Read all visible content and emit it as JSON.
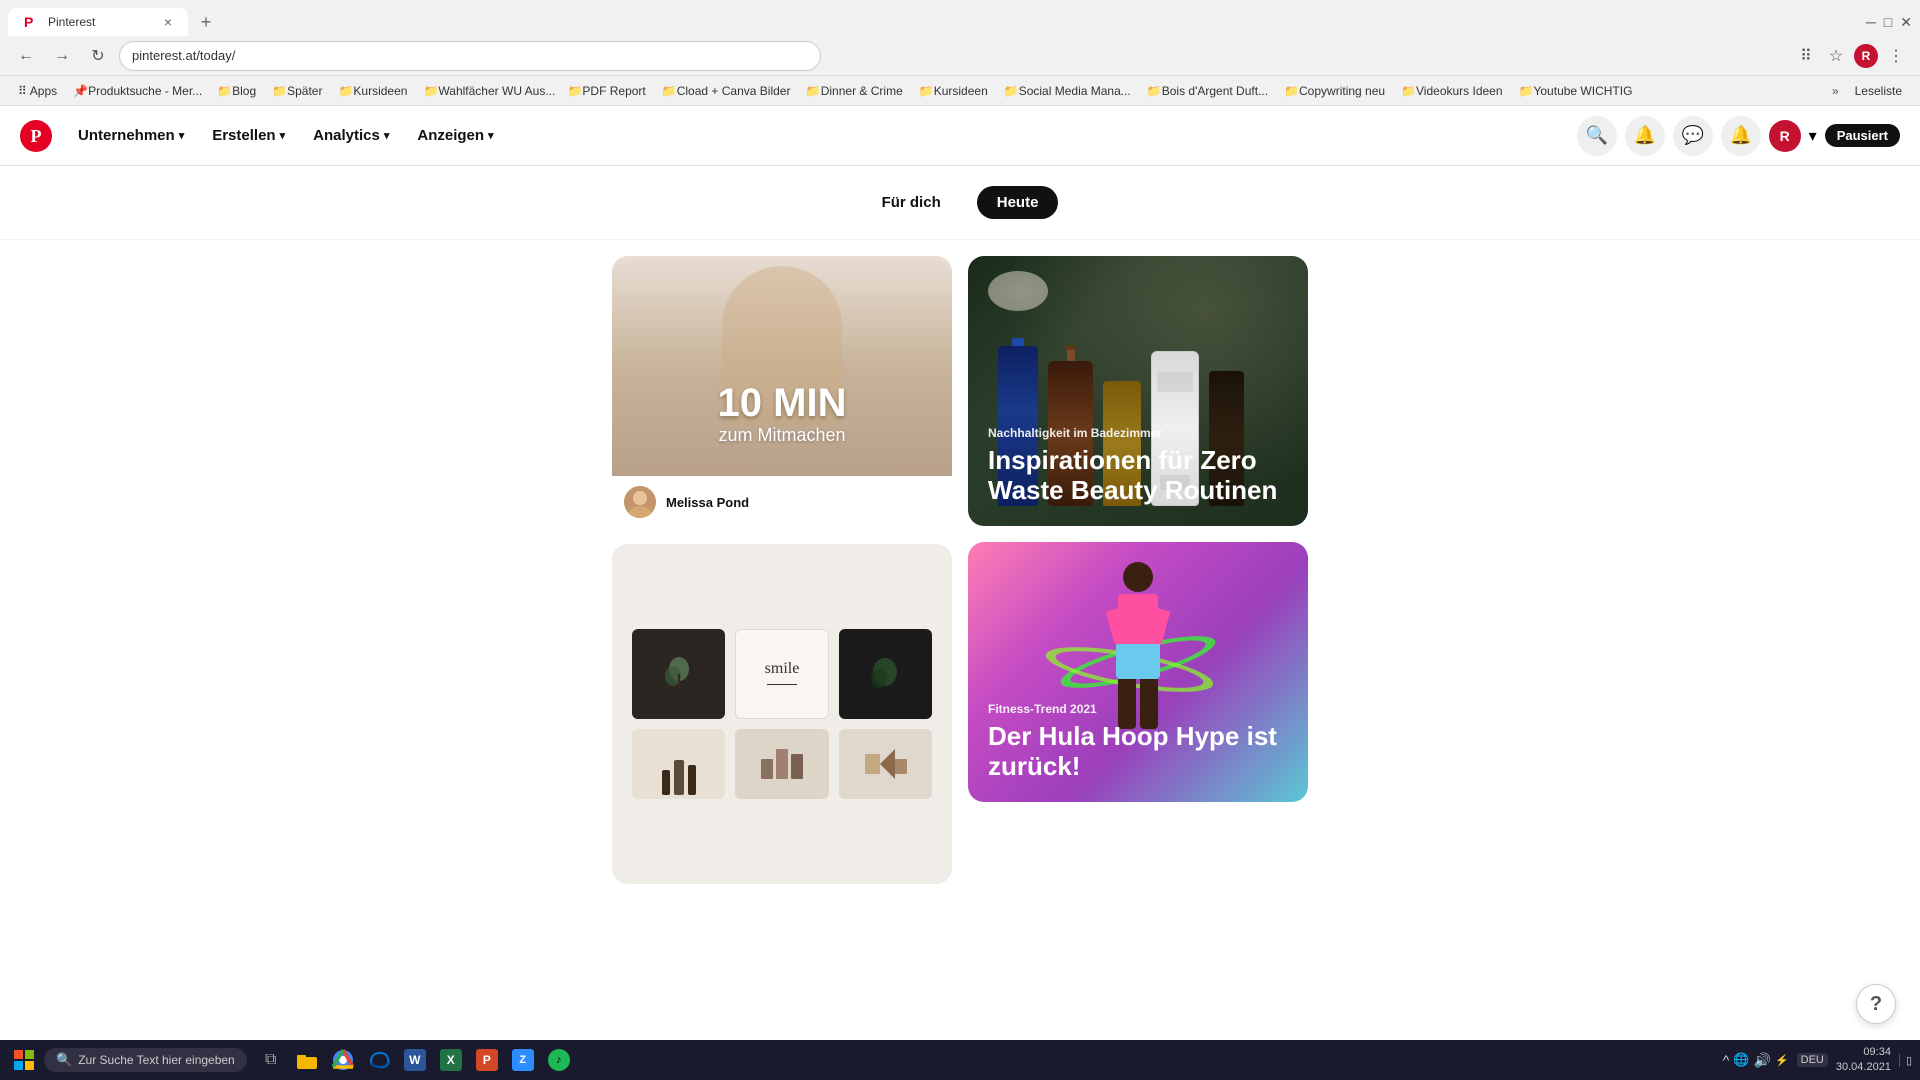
{
  "browser": {
    "tab": {
      "title": "Pinterest",
      "favicon": "P",
      "close": "×"
    },
    "address": "pinterest.at/today/",
    "nav": {
      "back": "←",
      "forward": "→",
      "refresh": "↻",
      "home": "⌂"
    }
  },
  "bookmarks": [
    {
      "label": "Apps",
      "icon": "⠿"
    },
    {
      "label": "Produktsuche - Mer...",
      "icon": "📌"
    },
    {
      "label": "Blog",
      "icon": "📁"
    },
    {
      "label": "Später",
      "icon": "📁"
    },
    {
      "label": "Kursideen",
      "icon": "📁"
    },
    {
      "label": "Wahlfächer WU Aus...",
      "icon": "📁"
    },
    {
      "label": "PDF Report",
      "icon": "📁"
    },
    {
      "label": "Cload + Canva Bilder",
      "icon": "📁"
    },
    {
      "label": "Dinner & Crime",
      "icon": "📁"
    },
    {
      "label": "Kursideen",
      "icon": "📁"
    },
    {
      "label": "Social Media Mana...",
      "icon": "📁"
    },
    {
      "label": "Bois d'Argent Duft...",
      "icon": "📁"
    },
    {
      "label": "Copywriting neu",
      "icon": "📁"
    },
    {
      "label": "Videokurs Ideen",
      "icon": "📁"
    },
    {
      "label": "Youtube WICHTIG",
      "icon": "📁"
    }
  ],
  "bookmarks_more": "»",
  "bookmarks_leseliste": "Leseliste",
  "pinterest": {
    "logo": "P",
    "nav": {
      "company": "Unternehmen",
      "create": "Erstellen",
      "analytics": "Analytics",
      "ads": "Anzeigen"
    },
    "header_icons": {
      "search": "🔍",
      "notifications": "🔔",
      "messages": "💬",
      "updates": "🔔",
      "chevron": "▾"
    },
    "pause_label": "Pausiert",
    "tabs": {
      "for_you": "Für dich",
      "today": "Heute"
    }
  },
  "pins": [
    {
      "id": "pin-workout",
      "type": "workout",
      "big_text": "10 MIN",
      "sub_text": "zum Mitmachen",
      "user_name": "Melissa Pond",
      "has_footer": true
    },
    {
      "id": "pin-bathroom",
      "type": "bathroom",
      "category": "Nachhaltigkeit im Badezimmer",
      "title": "Inspirationen für Zero Waste Beauty Routinen",
      "has_footer": false
    },
    {
      "id": "pin-moodboard",
      "type": "moodboard",
      "has_footer": false
    },
    {
      "id": "pin-hula",
      "type": "hula",
      "category": "Fitness-Trend 2021",
      "title": "Der Hula Hoop Hype ist zurück!",
      "has_footer": false
    }
  ],
  "help_btn": "?",
  "taskbar": {
    "search_placeholder": "Zur Suche Text hier eingeben",
    "time": "09:34",
    "date": "30.04.2021",
    "lang": "DEU"
  }
}
